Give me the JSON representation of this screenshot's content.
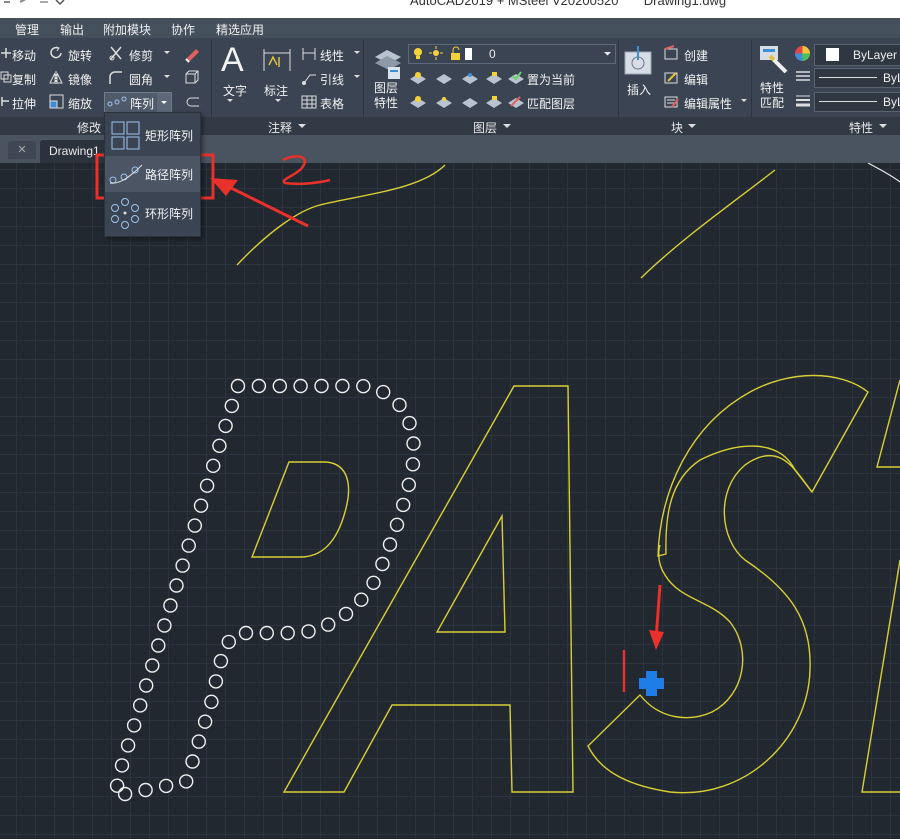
{
  "window": {
    "title": "AutoCAD2019 + MSteel V20200520       Drawing1.dwg"
  },
  "menu": [
    "管理",
    "输出",
    "附加模块",
    "协作",
    "精选应用"
  ],
  "modify": {
    "move": "移动",
    "rotate": "旋转",
    "trim": "修剪",
    "copy": "复制",
    "mirror": "镜像",
    "fillet": "圆角",
    "stretch": "拉伸",
    "scale": "缩放",
    "array": "阵列",
    "panel": "修改"
  },
  "annotation": {
    "text": "文字",
    "dimension": "标注",
    "linear": "线性",
    "leader": "引线",
    "table": "表格",
    "panel": "注释"
  },
  "layers": {
    "current_layer": "0",
    "properties": "图层\n特性",
    "set_current": "置为当前",
    "match_layer": "匹配图层",
    "panel": "图层"
  },
  "block": {
    "insert": "插入",
    "create": "创建",
    "edit": "编辑",
    "edit_attributes": "编辑属性",
    "panel": "块"
  },
  "properties": {
    "match": "特性\n匹配",
    "color": "ByLayer",
    "linetype": "ByL",
    "lineweight": "ByL",
    "panel": "特性"
  },
  "tabs": {
    "drawing": "Drawing1"
  },
  "array_menu": {
    "rect": "矩形阵列",
    "path": "路径阵列",
    "polar": "环形阵列"
  },
  "colors": {
    "accent_red": "#e8312a",
    "geometry_yellow": "#d9cf35",
    "grip_blue": "#1e7de6"
  }
}
